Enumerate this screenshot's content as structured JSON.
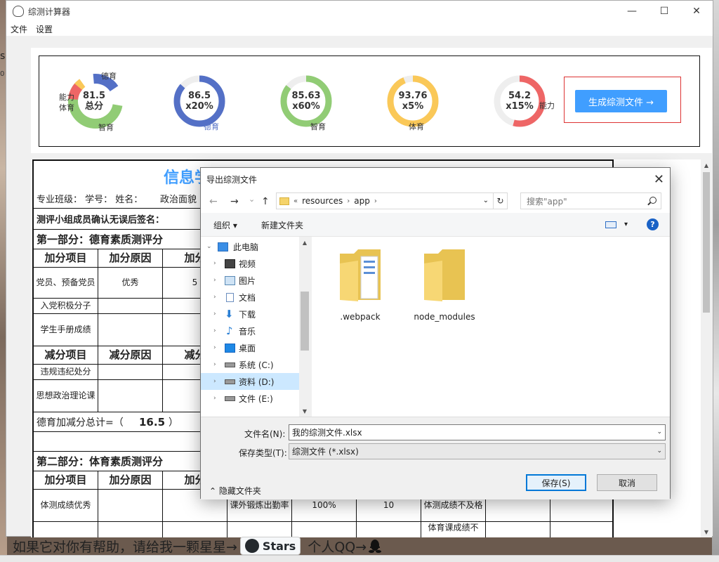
{
  "window": {
    "title": "综测计算器",
    "minimize": "—",
    "maximize": "☐",
    "close": "✕"
  },
  "menu": [
    {
      "label": "文件"
    },
    {
      "label": "设置"
    }
  ],
  "scores": {
    "total": {
      "value": "81.5",
      "caption": "总分",
      "labels": [
        "德育",
        "能力",
        "体育",
        "智育"
      ]
    },
    "moral": {
      "value": "86.5",
      "weight": "x20%",
      "label": "德育",
      "fill": 0.865,
      "color": "#5470c6"
    },
    "intellect": {
      "value": "85.63",
      "weight": "x60%",
      "label": "智育",
      "fill": 0.8563,
      "color": "#91cc75"
    },
    "sports": {
      "value": "93.76",
      "weight": "x5%",
      "label": "体育",
      "fill": 0.9376,
      "color": "#fac858"
    },
    "ability": {
      "value": "54.2",
      "weight": "x15%",
      "label": "能力",
      "fill": 0.542,
      "color": "#ee6666"
    }
  },
  "generate_button": "生成综测文件 →",
  "form": {
    "title": "信息学",
    "class_line": "专业班级：  学号：  姓名：",
    "political": "政治面貌",
    "signature_line": "测评小组成员确认无误后签名：",
    "part1": "第一部分：德育素质测评分",
    "headers": [
      "加分项目",
      "加分原因",
      "加分"
    ],
    "rows": [
      {
        "item": "党员、预备党员",
        "reason": "优秀",
        "score": "5"
      },
      {
        "item": "入党积极分子",
        "reason": "",
        "score": ""
      },
      {
        "item": "学生手册成绩",
        "reason": "",
        "score": ""
      }
    ],
    "minus_headers": [
      "减分项目",
      "减分原因",
      "减分"
    ],
    "minus_rows": [
      {
        "item": "违规违纪处分"
      },
      {
        "item": "思想政治理论课"
      }
    ],
    "moral_total_label": "德育加减分总计=（",
    "moral_total_value": "16.5",
    "moral_total_end": "）",
    "part2": "第二部分：体育素质测评分",
    "p2_headers": [
      "加分项目",
      "加分原因",
      "加分"
    ],
    "p2_rows": [
      {
        "item": "体测成绩优秀",
        "c4": "课外锻炼出勤率",
        "c5": "100%",
        "c6": "10",
        "c7": "体测成绩不及格"
      }
    ],
    "p2_next": "体育课成绩不"
  },
  "banner": {
    "text1": "如果它对你有帮助，请给我一颗星星→",
    "stars": "Stars",
    "text2": "个人QQ→"
  },
  "bg_texts": {
    "left1": "s",
    "left2": "0"
  },
  "dialog": {
    "title": "导出综测文件",
    "close": "✕",
    "nav": {
      "back": "←",
      "forward": "→",
      "recent": "⌄",
      "up": "↑"
    },
    "address": {
      "prefix": "«",
      "crumbs": [
        "resources",
        "app"
      ],
      "sep": "›"
    },
    "search_placeholder": "搜索\"app\"",
    "toolbar": {
      "organize": "组织 ▾",
      "new_folder": "新建文件夹",
      "view_dd": "▾",
      "help": "?"
    },
    "tree": [
      {
        "label": "此电脑",
        "icon": "pc-icon",
        "arrow": "⌄"
      },
      {
        "label": "视频",
        "icon": "video-icon",
        "arrow": "›"
      },
      {
        "label": "图片",
        "icon": "pictures-icon",
        "arrow": "›"
      },
      {
        "label": "文档",
        "icon": "documents-icon",
        "arrow": "›"
      },
      {
        "label": "下载",
        "icon": "download-icon",
        "arrow": "›"
      },
      {
        "label": "音乐",
        "icon": "music-icon",
        "arrow": "›"
      },
      {
        "label": "桌面",
        "icon": "desktop-icon",
        "arrow": "›"
      },
      {
        "label": "系统 (C:)",
        "icon": "drive-icon",
        "arrow": "›"
      },
      {
        "label": "资料 (D:)",
        "icon": "drive-icon",
        "arrow": "›",
        "selected": true
      },
      {
        "label": "文件 (E:)",
        "icon": "drive-icon",
        "arrow": "›"
      }
    ],
    "files": [
      {
        "name": ".webpack",
        "icon": "folder-icon"
      },
      {
        "name": "node_modules",
        "icon": "folder-icon"
      }
    ],
    "filename_label": "文件名(N):",
    "filename_value": "我的综测文件.xlsx",
    "filetype_label": "保存类型(T):",
    "filetype_value": "综测文件 (*.xlsx)",
    "hide_folders": "⌃ 隐藏文件夹",
    "save": "保存(S)",
    "cancel": "取消"
  }
}
